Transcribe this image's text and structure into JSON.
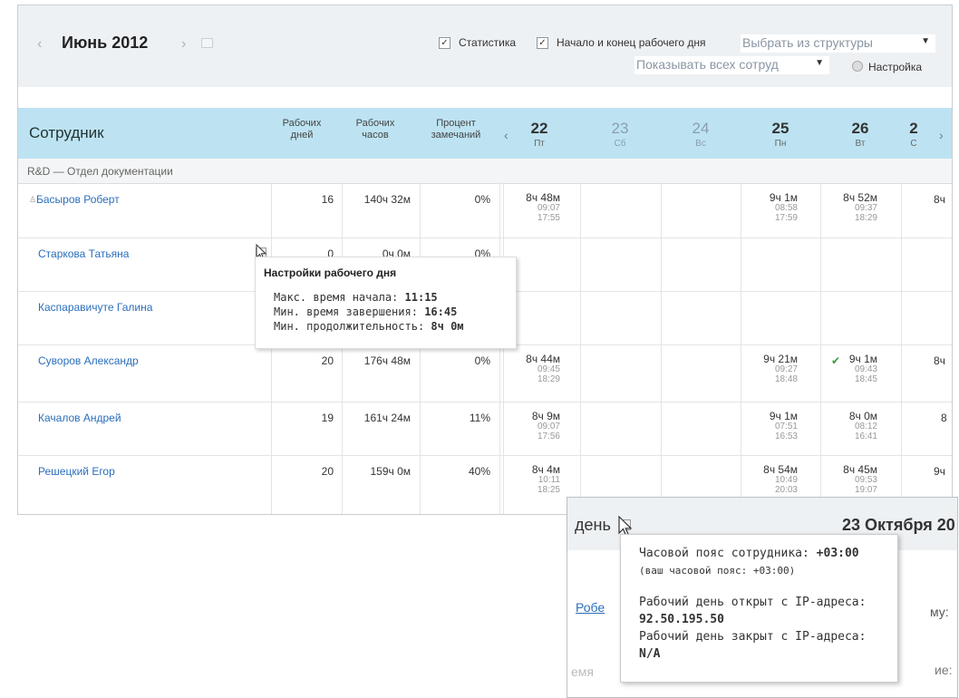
{
  "toolbar": {
    "prev": "‹",
    "month": "Июнь 2012",
    "next": "›",
    "statistics_checked": true,
    "statistics_label": "Статистика",
    "daybounds_checked": true,
    "daybounds_label": "Начало и конец рабочего дня",
    "structure_select": "Выбрать из структуры",
    "employees_select": "Показывать всех сотруд",
    "settings_label": "Настройка"
  },
  "table": {
    "employee_header": "Сотрудник",
    "col_workdays": [
      "Рабочих",
      "дней"
    ],
    "col_workhours": [
      "Рабочих",
      "часов"
    ],
    "col_percent": [
      "Процент",
      "замечаний"
    ],
    "days": [
      {
        "num": "22",
        "wd": "Пт",
        "weekend": false
      },
      {
        "num": "23",
        "wd": "Сб",
        "weekend": true
      },
      {
        "num": "24",
        "wd": "Вс",
        "weekend": true
      },
      {
        "num": "25",
        "wd": "Пн",
        "weekend": false
      },
      {
        "num": "26",
        "wd": "Вт",
        "weekend": false
      },
      {
        "num": "2",
        "wd": "С",
        "weekend": false
      }
    ],
    "department": "R&D — Отдел документации",
    "rows": [
      {
        "name": "Басыров Роберт",
        "days": "16",
        "hours": "140ч 32м",
        "percent": "0%",
        "d22": [
          "8ч 48м",
          "09:07",
          "17:55"
        ],
        "d25": [
          "9ч 1м",
          "08:58",
          "17:59"
        ],
        "d26": [
          "8ч 52м",
          "09:37",
          "18:29"
        ],
        "d27": "8ч"
      },
      {
        "name": "Старкова Татьяна",
        "days": "0",
        "hours": "0ч 0м",
        "percent": "0%"
      },
      {
        "name": "Каспаравичуте Галина"
      },
      {
        "name": "Суворов Александр",
        "days": "20",
        "hours": "176ч 48м",
        "percent": "0%",
        "d22": [
          "8ч 44м",
          "09:45",
          "18:29"
        ],
        "d25": [
          "9ч 21м",
          "09:27",
          "18:48"
        ],
        "d26": [
          "9ч 1м",
          "09:43",
          "18:45"
        ],
        "d27": "8ч"
      },
      {
        "name": "Качалов Андрей",
        "days": "19",
        "hours": "161ч 24м",
        "percent": "11%",
        "d22": [
          "8ч 9м",
          "09:07",
          "17:56"
        ],
        "d25": [
          "9ч 1м",
          "07:51",
          "16:53"
        ],
        "d26": [
          "8ч 0м",
          "08:12",
          "16:41"
        ],
        "d27": "8"
      },
      {
        "name": "Решецкий Егор",
        "days": "20",
        "hours": "159ч 0м",
        "percent": "40%",
        "d22": [
          "8ч 4м",
          "10:11",
          "18:25"
        ],
        "d25": [
          "8ч 54м",
          "10:49",
          "20:03"
        ],
        "d26": [
          "8ч 45м",
          "09:53",
          "19:07"
        ],
        "d27": "9ч"
      }
    ]
  },
  "tooltip_workday": {
    "title": "Настройки рабочего дня",
    "max_start_label": "Макс. время начала:",
    "max_start_value": "11:15",
    "min_end_label": "Мин. время завершения:",
    "min_end_value": "16:45",
    "min_duration_label": "Мин. продолжительность:",
    "min_duration_value": "8ч 0м"
  },
  "detail": {
    "day_label": "день",
    "date": "23 Октября 20",
    "link": "Робе",
    "right_text": "му:",
    "left_bottom": "емя",
    "right_bottom": "ие:"
  },
  "tooltip_timezone": {
    "tz_label": "Часовой пояс сотрудника:",
    "tz_value": "+03:00",
    "your_tz": "(ваш часовой пояс: +03:00)",
    "opened_label": "Рабочий день открыт с IP-адреса:",
    "opened_ip": "92.50.195.50",
    "closed_label": "Рабочий день закрыт с IP-адреса:",
    "closed_ip": "N/A"
  }
}
